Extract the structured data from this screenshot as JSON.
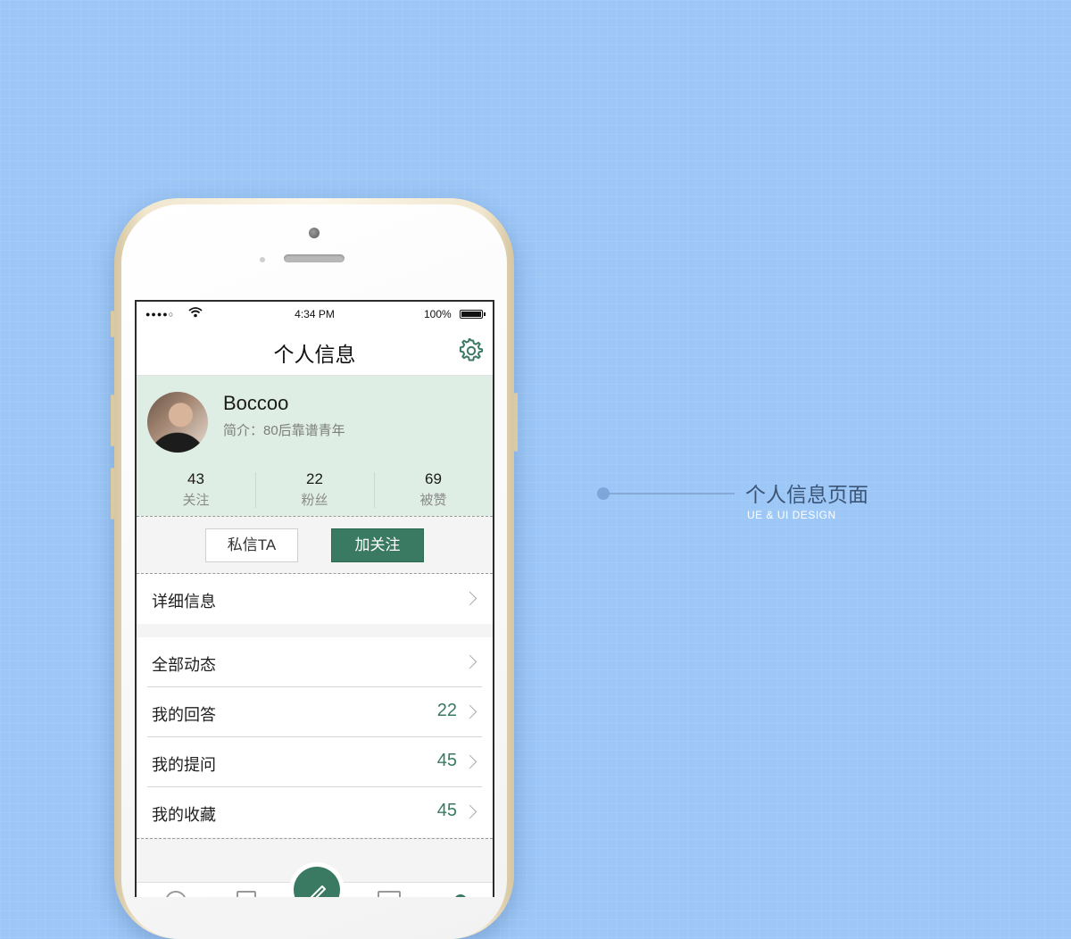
{
  "status_bar": {
    "time": "4:34 PM",
    "battery": "100%"
  },
  "nav": {
    "title": "个人信息",
    "settings_icon": "gear-icon"
  },
  "profile": {
    "name": "Boccoo",
    "bio": "简介：80后靠谱青年",
    "stats": [
      {
        "value": "43",
        "label": "关注"
      },
      {
        "value": "22",
        "label": "粉丝"
      },
      {
        "value": "69",
        "label": "被赞"
      }
    ]
  },
  "actions": {
    "message": "私信TA",
    "follow": "加关注"
  },
  "menu": {
    "details": "详细信息",
    "items": [
      {
        "label": "全部动态",
        "count": ""
      },
      {
        "label": "我的回答",
        "count": "22"
      },
      {
        "label": "我的提问",
        "count": "45"
      },
      {
        "label": "我的收藏",
        "count": "45"
      }
    ]
  },
  "callout": {
    "title": "个人信息页面",
    "subtitle": "UE & UI  DESIGN"
  },
  "colors": {
    "background": "#9cc7f7",
    "accent": "#3a7a62",
    "profile_bg": "#dfeee4"
  }
}
